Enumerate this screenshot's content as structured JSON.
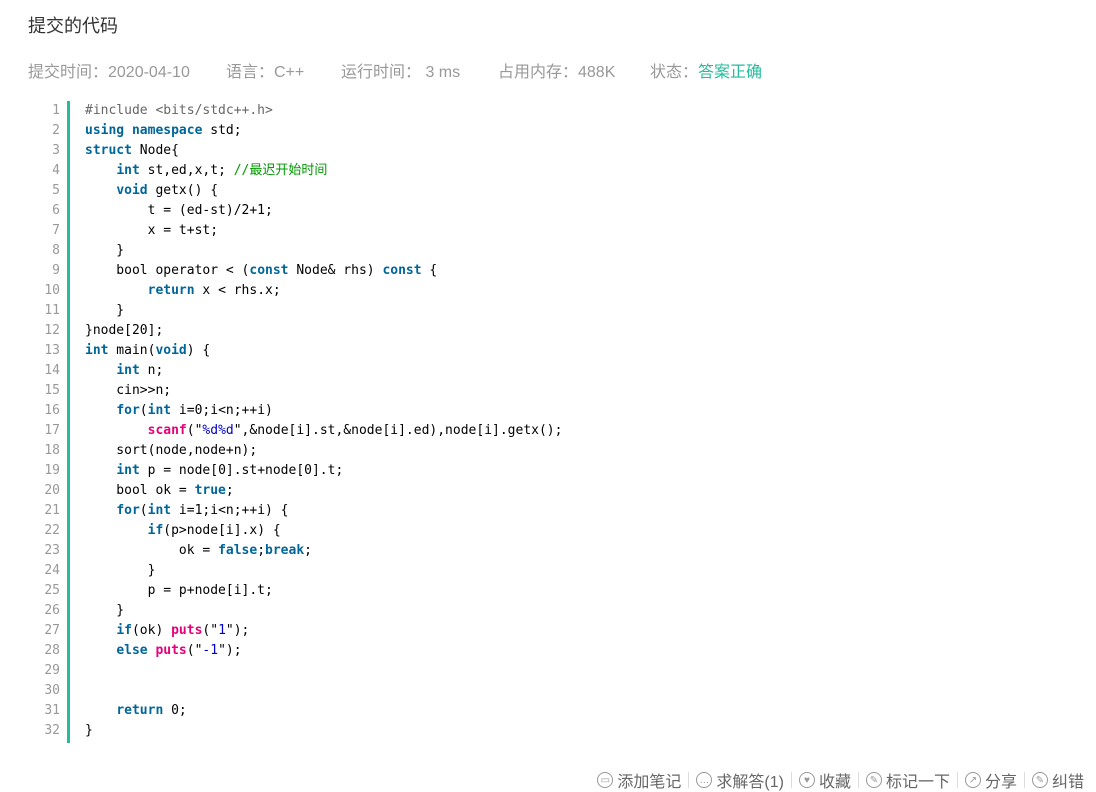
{
  "page_title": "提交的代码",
  "meta": {
    "submit_time": "提交时间：2020-04-10",
    "language": "语言：C++",
    "run_time": "运行时间： 3 ms",
    "memory": "占用内存：488K",
    "status_label": "状态：",
    "status_value": "答案正确"
  },
  "code": {
    "line_numbers": [
      "1",
      "2",
      "3",
      "4",
      "5",
      "6",
      "7",
      "8",
      "9",
      "10",
      "11",
      "12",
      "13",
      "14",
      "15",
      "16",
      "17",
      "18",
      "19",
      "20",
      "21",
      "22",
      "23",
      "24",
      "25",
      "26",
      "27",
      "28",
      "29",
      "30",
      "31",
      "32"
    ],
    "lines": [
      "#include <bits/stdc++.h>",
      "using namespace std;",
      "struct Node{",
      "    int st,ed,x,t; //最迟开始时间",
      "    void getx() {",
      "        t = (ed-st)/2+1;",
      "        x = t+st;",
      "    }",
      "    bool operator < (const Node& rhs) const {",
      "        return x < rhs.x;",
      "    }",
      "}node[20];",
      "int main(void) {",
      "    int n;",
      "    cin>>n;",
      "    for(int i=0;i<n;++i)",
      "        scanf(\"%d%d\",&node[i].st,&node[i].ed),node[i].getx();",
      "    sort(node,node+n);",
      "    int p = node[0].st+node[0].t;",
      "    bool ok = true;",
      "    for(int i=1;i<n;++i) {",
      "        if(p>node[i].x) {",
      "            ok = false;break;",
      "        }",
      "        p = p+node[i].t;",
      "    }",
      "    if(ok) puts(\"1\");",
      "    else puts(\"-1\");",
      "",
      "",
      "    return 0;",
      "}"
    ]
  },
  "actions": [
    {
      "label": "添加笔记",
      "icon": "note-icon"
    },
    {
      "label": "求解答(1)",
      "icon": "comment-icon"
    },
    {
      "label": "收藏",
      "icon": "heart-icon"
    },
    {
      "label": "标记一下",
      "icon": "pencil-icon"
    },
    {
      "label": "分享",
      "icon": "share-icon"
    },
    {
      "label": "纠错",
      "icon": "edit-icon"
    }
  ],
  "colors": {
    "accent": "#25bb9b",
    "keyword": "#006699",
    "function": "#e6007a",
    "string": "#0000cc",
    "comment": "#009900"
  }
}
